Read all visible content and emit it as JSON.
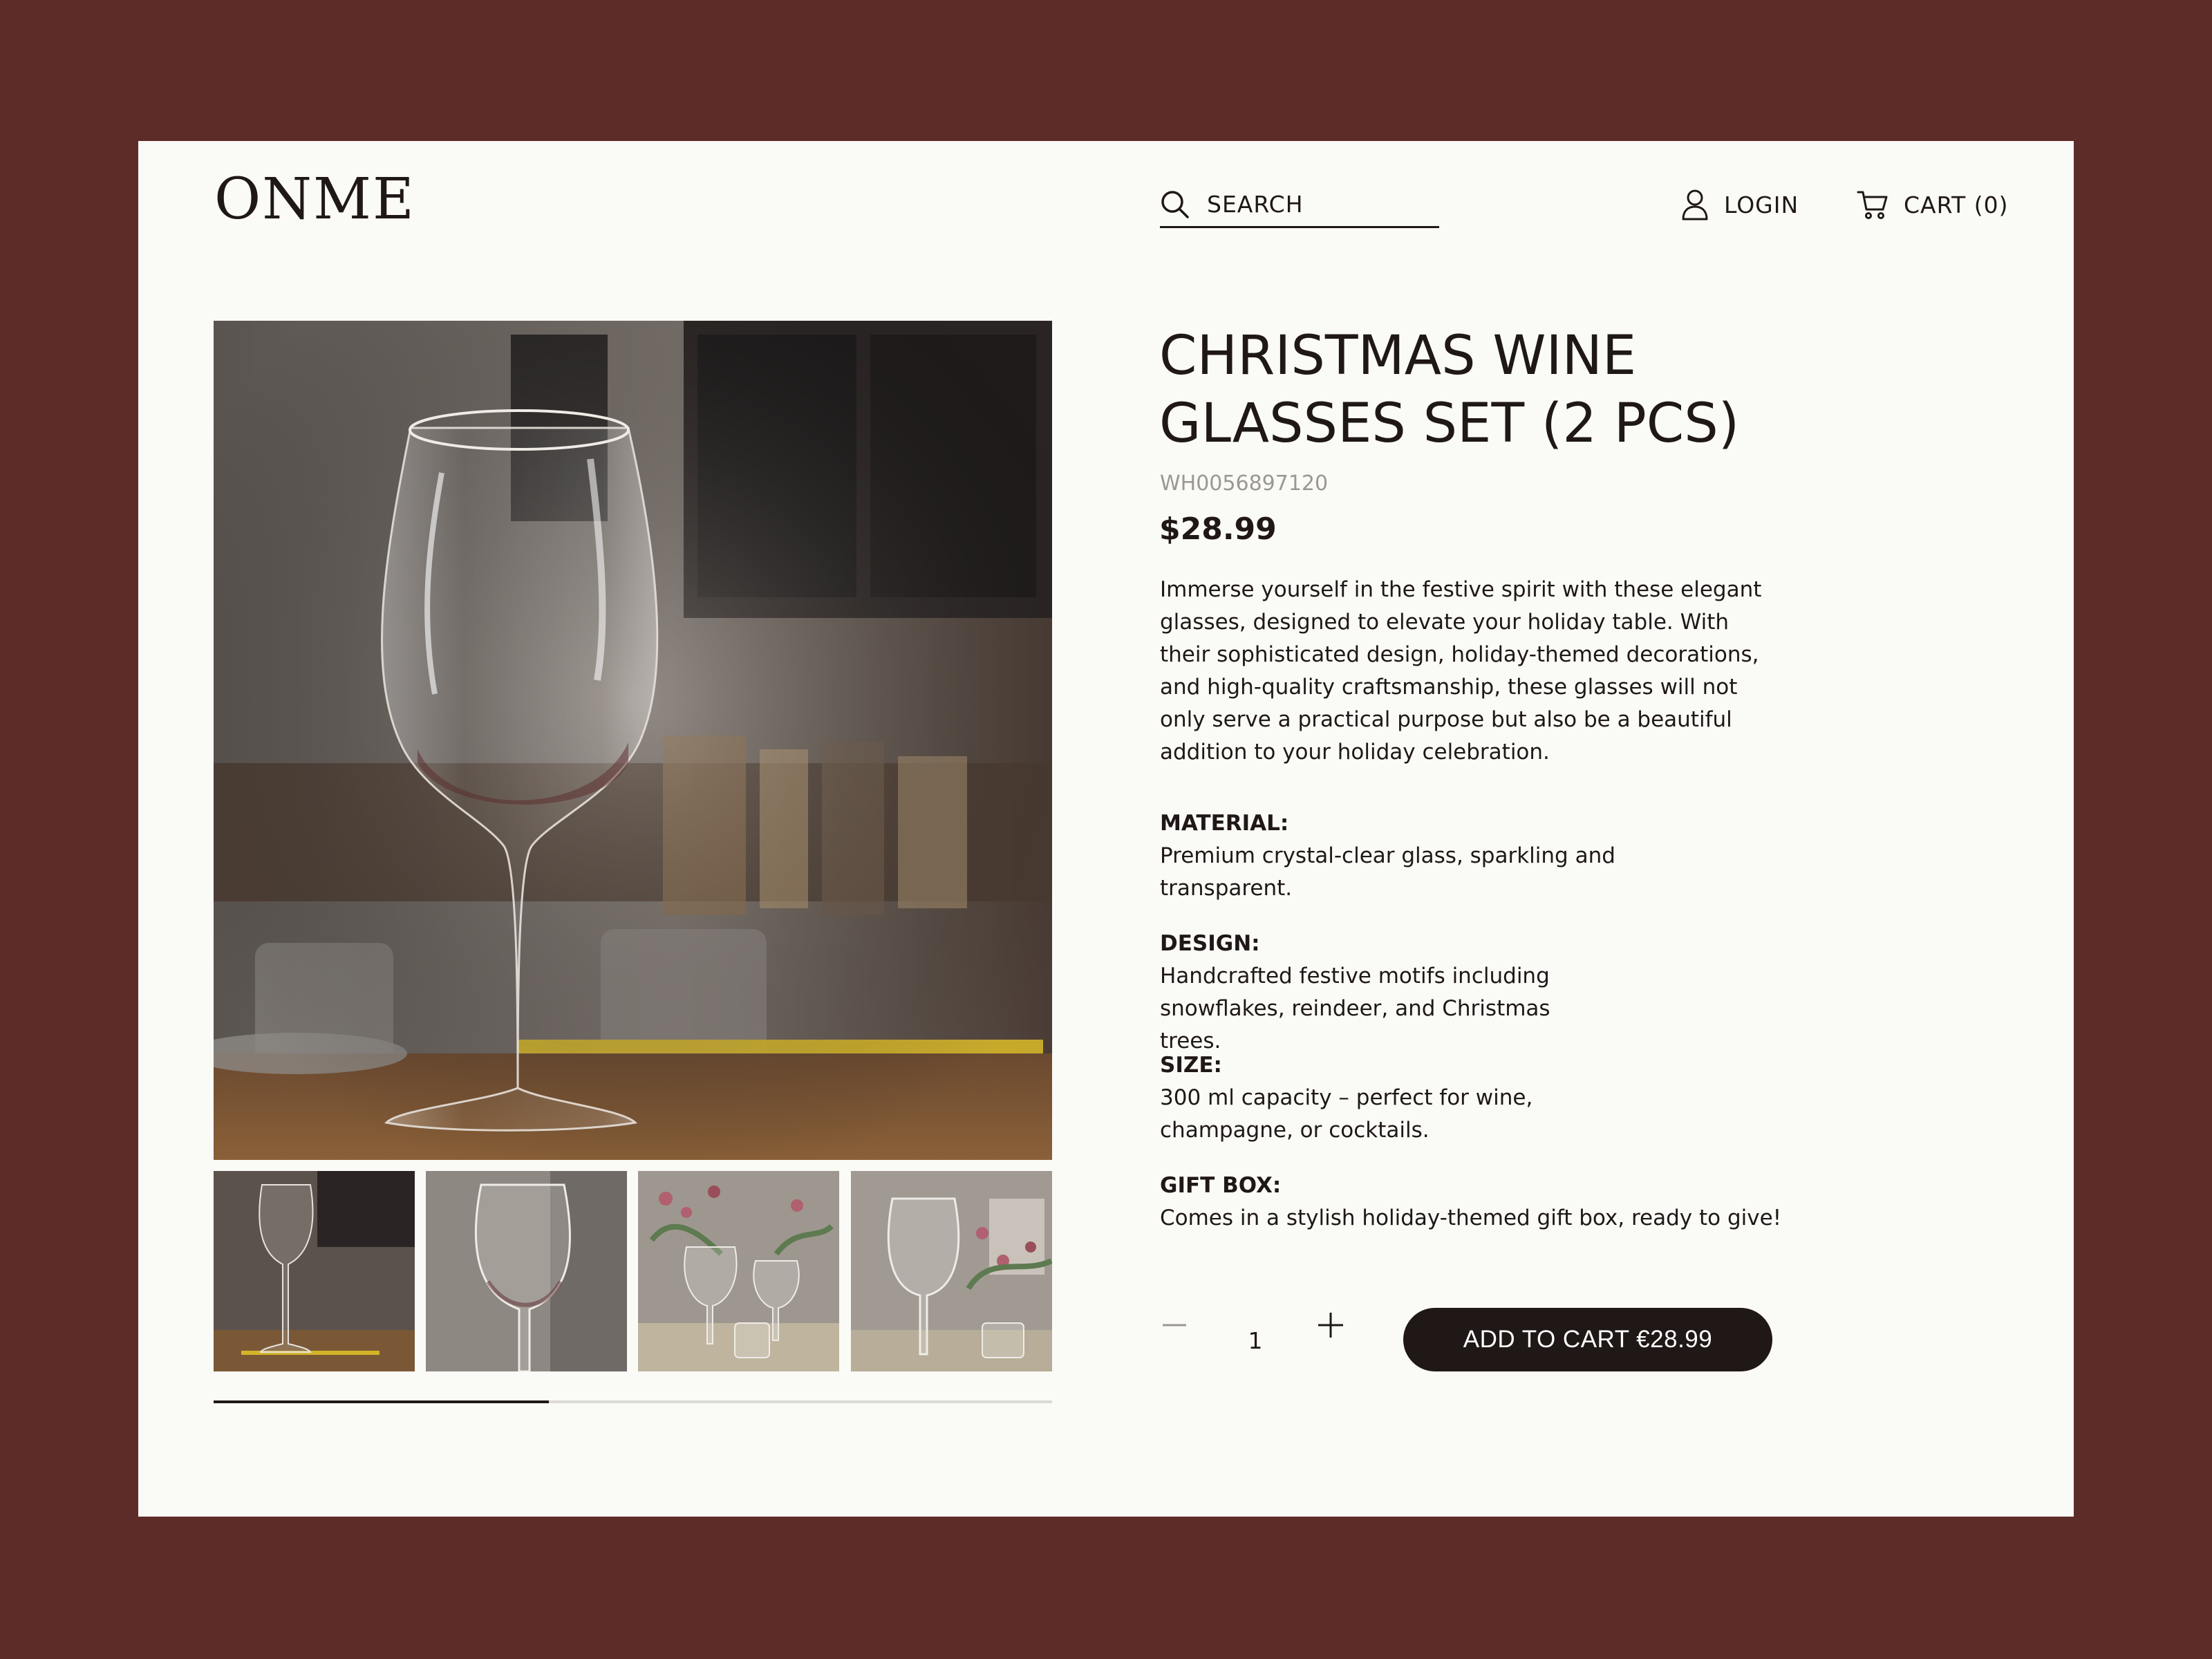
{
  "brand": {
    "logo": "ONME"
  },
  "header": {
    "search_placeholder": "SEARCH",
    "login_label": "LOGIN",
    "cart_label": "CART (0)"
  },
  "gallery": {
    "main_image_alt": "",
    "thumbnails": [
      "",
      "",
      "",
      ""
    ],
    "scroll_progress": 0.4
  },
  "product": {
    "title": "CHRISTMAS WINE GLASSES SET (2 PCS)",
    "sku": "WH0056897120",
    "price": "$28.99",
    "description": "Immerse yourself in the festive spirit with these elegant glasses, designed to elevate your holiday table. With their sophisticated design, holiday-themed decorations, and high-quality craftsmanship, these glasses will not only serve a practical purpose but also be a beautiful addition to your holiday celebration.",
    "specs": [
      {
        "label": "MATERIAL:",
        "text": "Premium crystal-clear glass, sparkling and transparent."
      },
      {
        "label": "DESIGN:",
        "text": "Handcrafted festive motifs including snowflakes, reindeer, and Christmas trees."
      },
      {
        "label": "SIZE:",
        "text": "300 ml capacity – perfect for wine, champagne, or cocktails."
      },
      {
        "label": "GIFT BOX:",
        "text": "Comes in a stylish holiday-themed gift box, ready to give!"
      }
    ]
  },
  "purchase": {
    "quantity": "1",
    "add_to_cart_label": "ADD TO CART €28.99"
  },
  "colors": {
    "background": "#5e2c28",
    "card": "#fafaf7",
    "text": "#1f1816",
    "muted": "#9a9794",
    "button": "#1f1816"
  },
  "icons": {
    "search": "search-icon",
    "login": "user-icon",
    "cart": "cart-icon",
    "minus": "minus-icon",
    "plus": "plus-icon"
  }
}
